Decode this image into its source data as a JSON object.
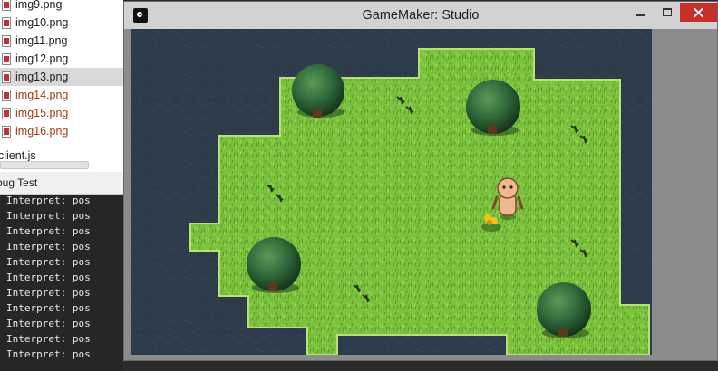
{
  "file_tree": {
    "items": [
      {
        "label": "img9.png",
        "state": "normal"
      },
      {
        "label": "img10.png",
        "state": "normal"
      },
      {
        "label": "img11.png",
        "state": "normal"
      },
      {
        "label": "img12.png",
        "state": "normal"
      },
      {
        "label": "img13.png",
        "state": "selected"
      },
      {
        "label": "img14.png",
        "state": "modified"
      },
      {
        "label": "img15.png",
        "state": "modified"
      },
      {
        "label": "img16.png",
        "state": "modified"
      },
      {
        "label": "client.js",
        "state": "normal"
      }
    ]
  },
  "panel_tab": {
    "label": "bug Test"
  },
  "console": {
    "lines": [
      "Interpret: pos",
      "Interpret: pos",
      "Interpret: pos",
      "Interpret: pos",
      "Interpret: pos",
      "Interpret: pos",
      "Interpret: pos",
      "Interpret: pos",
      "Interpret: pos",
      "Interpret: pos",
      "Interpret: pos"
    ]
  },
  "window": {
    "title": "GameMaker: Studio",
    "icon": "gamemaker-icon",
    "controls": [
      "minimize-icon",
      "maximize-icon",
      "close-icon"
    ]
  },
  "game": {
    "sprites": [
      "tree",
      "tree",
      "tree",
      "tree",
      "player-character",
      "yellow-flower",
      "grass-tuft"
    ],
    "colors": {
      "water": "#2d3b4a",
      "grass": "#7ac13c",
      "grass_dark": "#5c9a2a",
      "tree": "#2f6a3a",
      "close_button": "#c7302a"
    }
  }
}
